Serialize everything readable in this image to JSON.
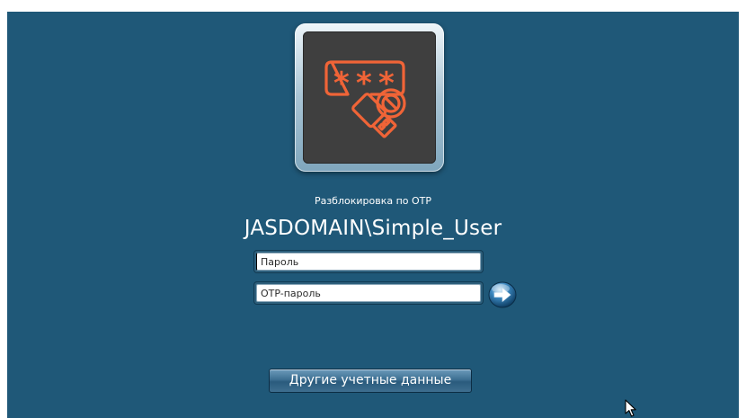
{
  "unlock": {
    "caption": "Разблокировка по ОТР",
    "username": "JASDOMAIN\\Simple_User",
    "password_placeholder": "Пароль",
    "otp_placeholder": "OTP-пароль",
    "other_credentials_label": "Другие учетные данные"
  },
  "icons": {
    "avatar": "otp-token-icon",
    "submit": "arrow-right-icon",
    "cursor": "mouse-pointer-icon"
  },
  "colors": {
    "background": "#1f5878",
    "tile": "#3f3f3f",
    "accent": "#f06437"
  }
}
